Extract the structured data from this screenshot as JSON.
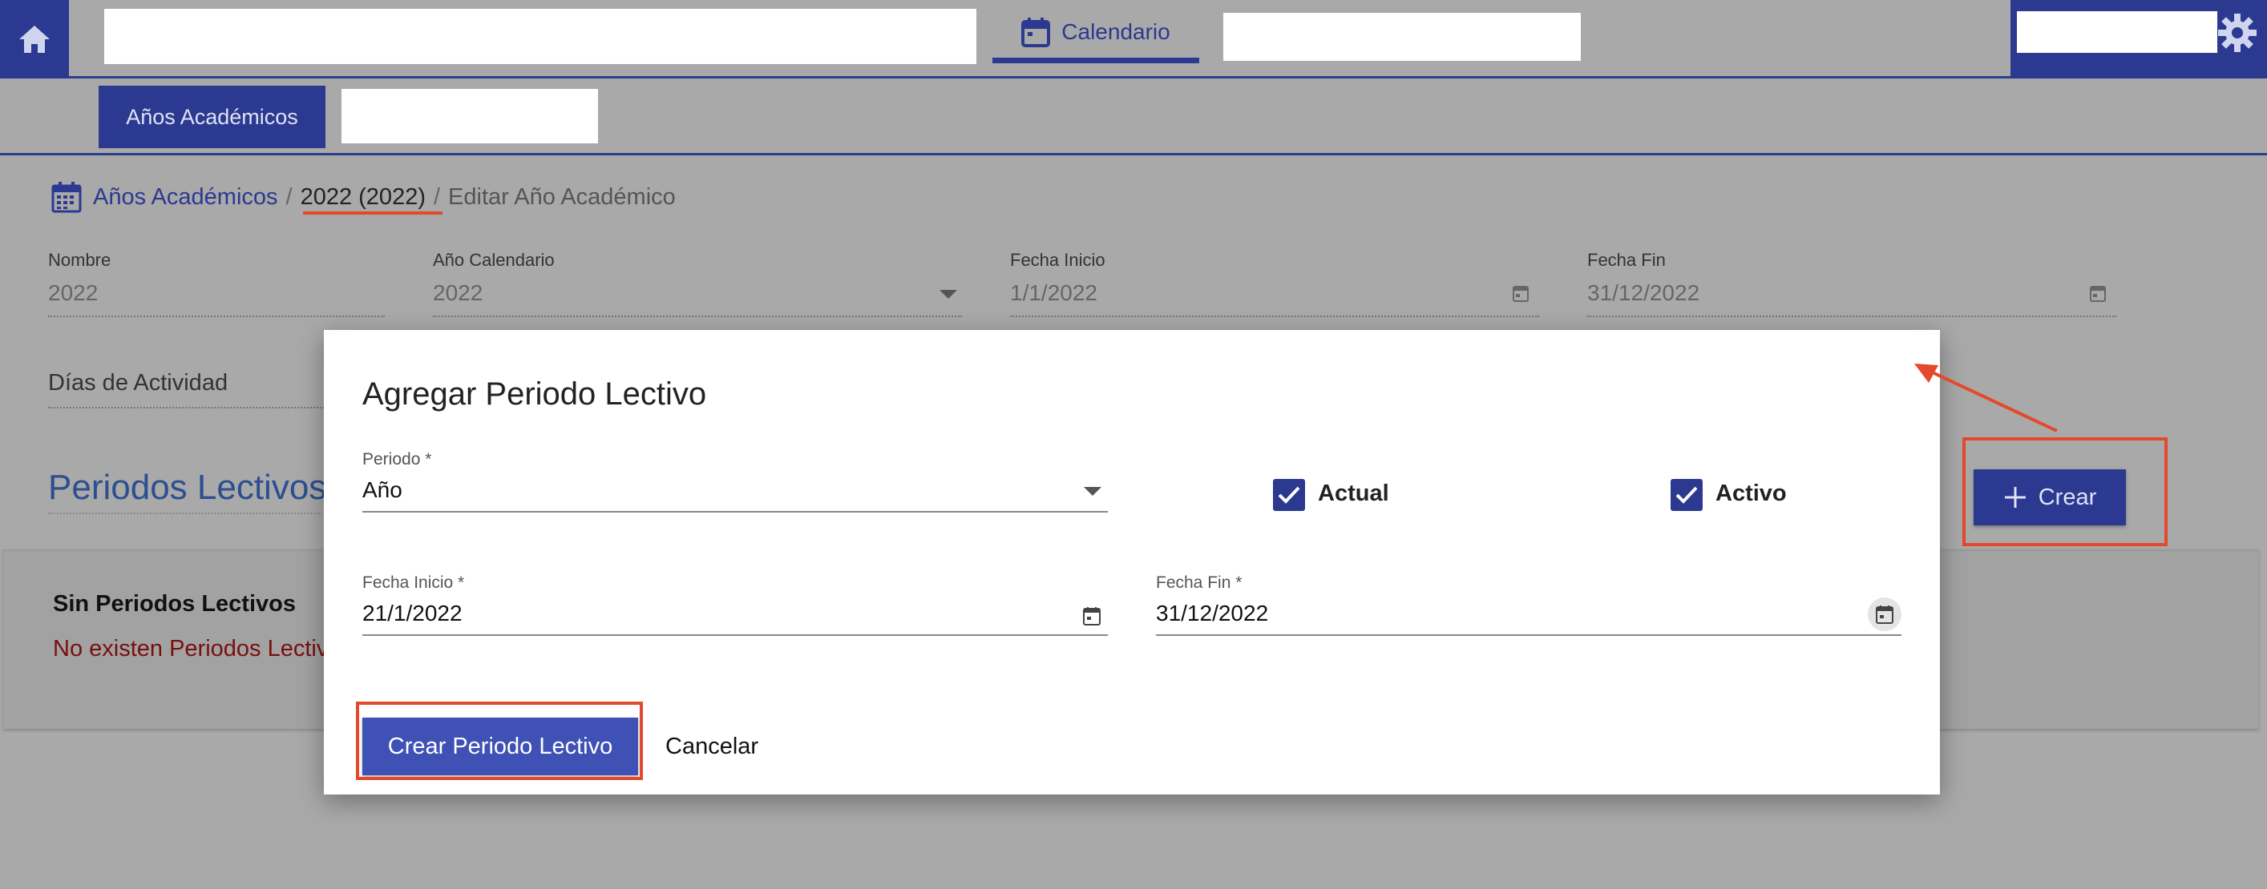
{
  "topbar": {
    "calendar_tab_label": "Calendario"
  },
  "subbar": {
    "years_tab_label": "Años Académicos"
  },
  "breadcrumb": {
    "items": [
      "Años Académicos",
      "2022 (2022)",
      "Editar Año Académico"
    ],
    "separator": "/"
  },
  "form": {
    "nombre": {
      "label": "Nombre",
      "value": "2022"
    },
    "anio_calendario": {
      "label": "Año Calendario",
      "value": "2022"
    },
    "fecha_inicio": {
      "label": "Fecha Inicio",
      "value": "1/1/2022"
    },
    "fecha_fin": {
      "label": "Fecha Fin",
      "value": "31/12/2022"
    },
    "dias_actividad": {
      "label": "Días de Actividad"
    }
  },
  "periods": {
    "title": "Periodos Lectivos",
    "create_button_label": "Crear",
    "empty_title": "Sin Periodos Lectivos",
    "empty_text": "No existen Periodos Lectivo"
  },
  "dialog": {
    "title": "Agregar Periodo Lectivo",
    "periodo": {
      "label": "Periodo *",
      "value": "Año"
    },
    "actual": {
      "label": "Actual",
      "checked": true
    },
    "activo": {
      "label": "Activo",
      "checked": true
    },
    "fecha_inicio": {
      "label": "Fecha Inicio *",
      "value": "21/1/2022"
    },
    "fecha_fin": {
      "label": "Fecha Fin *",
      "value": "31/12/2022"
    },
    "submit_label": "Crear Periodo Lectivo",
    "cancel_label": "Cancelar"
  },
  "colors": {
    "primary": "#2b3990",
    "button_primary": "#3f51b5",
    "annotation_red": "#e24a2b",
    "error_text": "#7a0e0e"
  }
}
